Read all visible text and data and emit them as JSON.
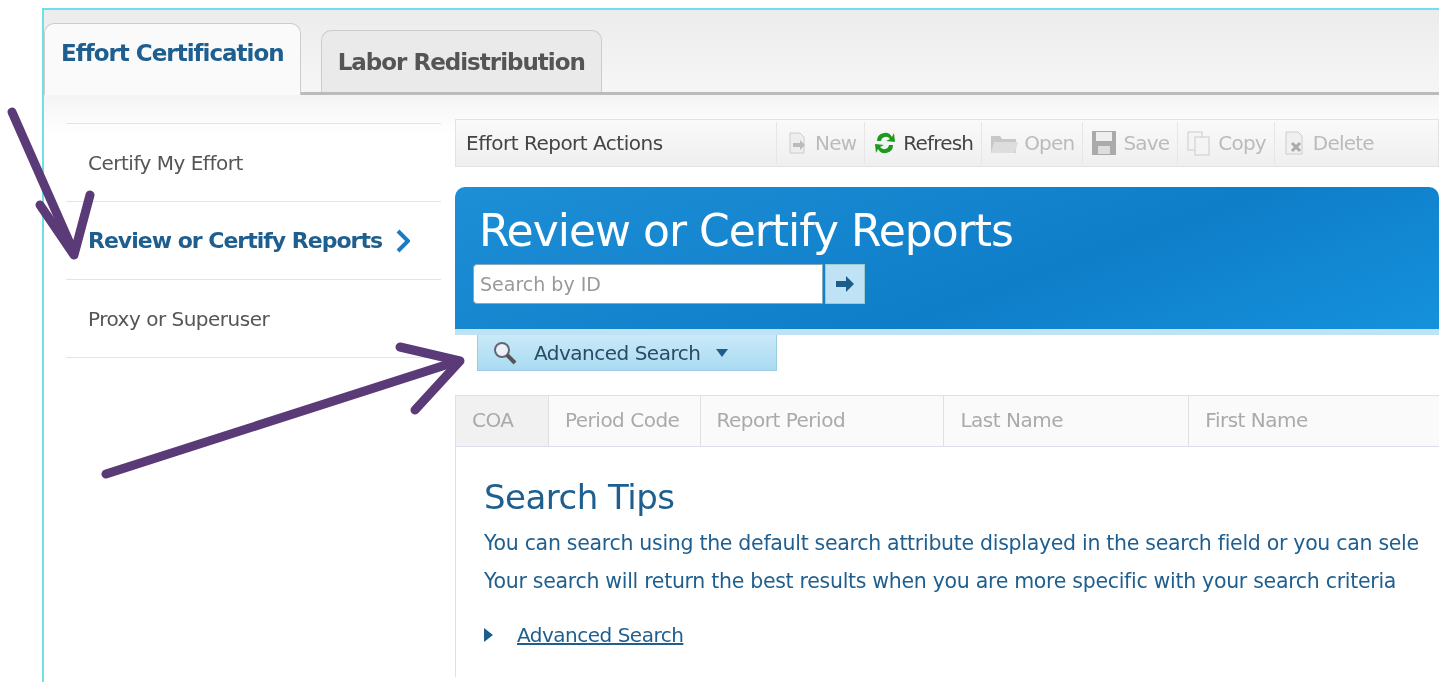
{
  "tabs": [
    {
      "label": "Effort Certification",
      "selected": true
    },
    {
      "label": "Labor Redistribution",
      "selected": false
    }
  ],
  "sidebar": {
    "items": [
      {
        "label": "Certify My Effort",
        "selected": false
      },
      {
        "label": "Review or Certify Reports",
        "selected": true
      },
      {
        "label": "Proxy or Superuser",
        "selected": false
      }
    ]
  },
  "toolbar": {
    "title": "Effort Report Actions",
    "buttons": [
      {
        "label": "New",
        "kind": "new",
        "disabled": true
      },
      {
        "label": "Refresh",
        "kind": "refresh",
        "disabled": false
      },
      {
        "label": "Open",
        "kind": "open",
        "disabled": true
      },
      {
        "label": "Save",
        "kind": "save",
        "disabled": true
      },
      {
        "label": "Copy",
        "kind": "copy",
        "disabled": true
      },
      {
        "label": "Delete",
        "kind": "delete",
        "disabled": true
      }
    ]
  },
  "header": {
    "title": "Review or Certify Reports",
    "search": {
      "placeholder": "Search by ID"
    }
  },
  "advanced_search_toggle": {
    "label": "Advanced Search"
  },
  "table": {
    "columns": [
      "COA",
      "Period Code",
      "Report Period",
      "Last Name",
      "First Name"
    ]
  },
  "search_tips": {
    "title": "Search Tips",
    "lines": [
      "You can search using the default search attribute displayed in the search field or you can sele",
      "Your search will return the best results when you are more specific with your search criteria"
    ],
    "link": "Advanced Search"
  }
}
